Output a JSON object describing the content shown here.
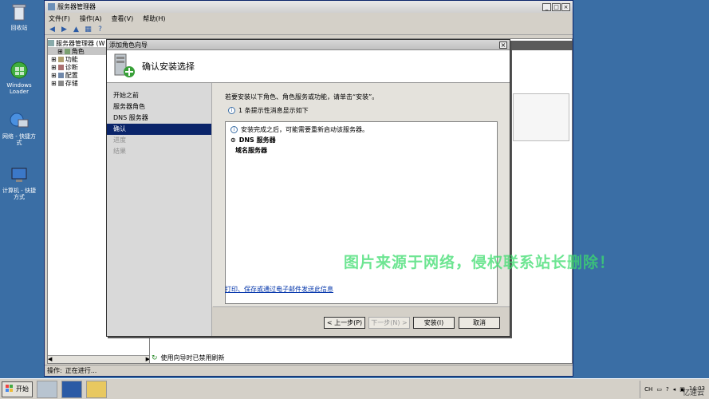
{
  "desktop": {
    "icons": [
      {
        "label": "回收站",
        "icon": "recycle-bin-icon"
      },
      {
        "label": "Windows Loader",
        "icon": "windows-loader-icon"
      },
      {
        "label": "网络 - 快捷方式",
        "icon": "network-icon"
      },
      {
        "label": "计算机 - 快捷方式",
        "icon": "computer-icon"
      }
    ]
  },
  "main_window": {
    "title": "服务器管理器",
    "menu": [
      "文件(F)",
      "操作(A)",
      "查看(V)",
      "帮助(H)"
    ],
    "tree": {
      "root": "服务器管理器 (W",
      "items": [
        "角色",
        "功能",
        "诊断",
        "配置",
        "存储"
      ]
    },
    "status": {
      "label": "操作:",
      "value": "正在进行..."
    },
    "refresh_text": "使用向导时已禁用刷新"
  },
  "dialog": {
    "title": "添加角色向导",
    "heading": "确认安装选择",
    "nav": [
      {
        "label": "开始之前",
        "state": "normal"
      },
      {
        "label": "服务器角色",
        "state": "normal"
      },
      {
        "label": "DNS 服务器",
        "state": "normal"
      },
      {
        "label": "确认",
        "state": "selected"
      },
      {
        "label": "进度",
        "state": "disabled"
      },
      {
        "label": "结果",
        "state": "disabled"
      }
    ],
    "instruction": "若要安装以下角色、角色服务或功能，请单击“安装”。",
    "hint": "1 条提示性消息显示如下",
    "list": {
      "info": "安装完成之后，可能需要重新启动该服务器。",
      "section": "DNS 服务器",
      "item": "域名服务器"
    },
    "print_link": "打印、保存或通过电子邮件发送此信息",
    "buttons": {
      "prev": "< 上一步(P)",
      "next": "下一步(N) >",
      "install": "安装(I)",
      "cancel": "取消"
    }
  },
  "watermark": "图片来源于网络，侵权联系站长删除！",
  "taskbar": {
    "start": "开始",
    "lang": "CH",
    "time": "14:03",
    "yisu": "亿速云"
  }
}
